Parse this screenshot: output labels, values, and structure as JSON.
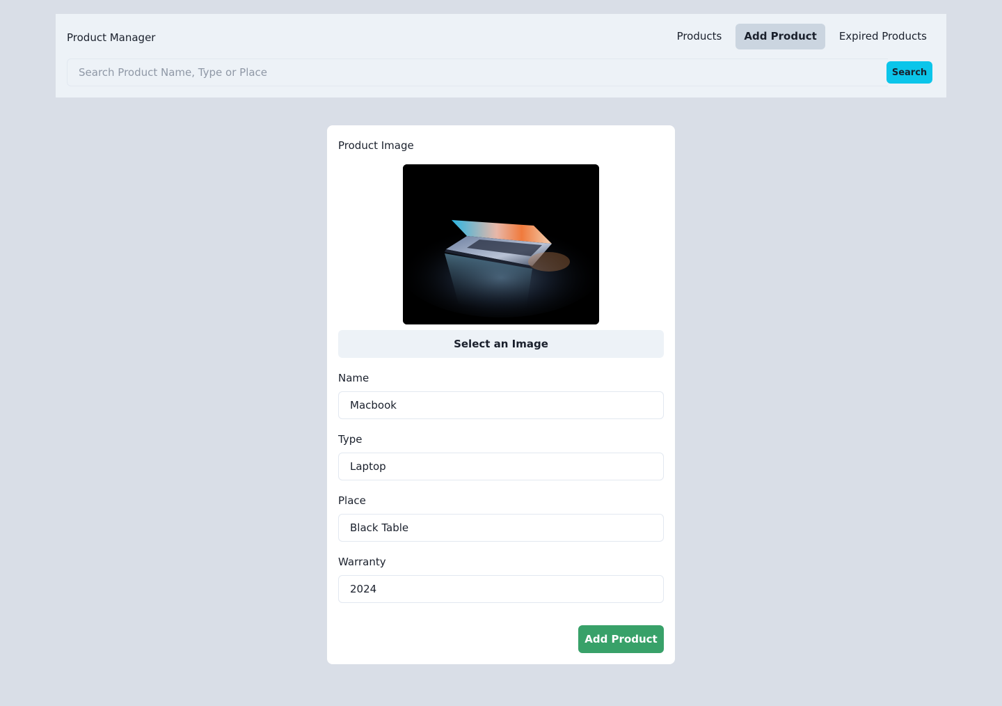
{
  "header": {
    "brand": "Product Manager",
    "nav": [
      {
        "label": "Products",
        "active": false
      },
      {
        "label": "Add Product",
        "active": true
      },
      {
        "label": "Expired Products",
        "active": false
      }
    ],
    "search": {
      "placeholder": "Search Product Name, Type or Place",
      "value": "",
      "button_label": "Search"
    }
  },
  "form": {
    "image_label": "Product Image",
    "select_image_label": "Select an Image",
    "fields": {
      "name": {
        "label": "Name",
        "value": "Macbook"
      },
      "type": {
        "label": "Type",
        "value": "Laptop"
      },
      "place": {
        "label": "Place",
        "value": "Black Table"
      },
      "warranty": {
        "label": "Warranty",
        "value": "2024"
      }
    },
    "submit_label": "Add Product"
  },
  "colors": {
    "page_bg": "#d9dee7",
    "header_bg": "#edf2f7",
    "search_button": "#0bc5ea",
    "submit_button": "#38a169",
    "active_nav_bg": "#cbd5e0"
  }
}
